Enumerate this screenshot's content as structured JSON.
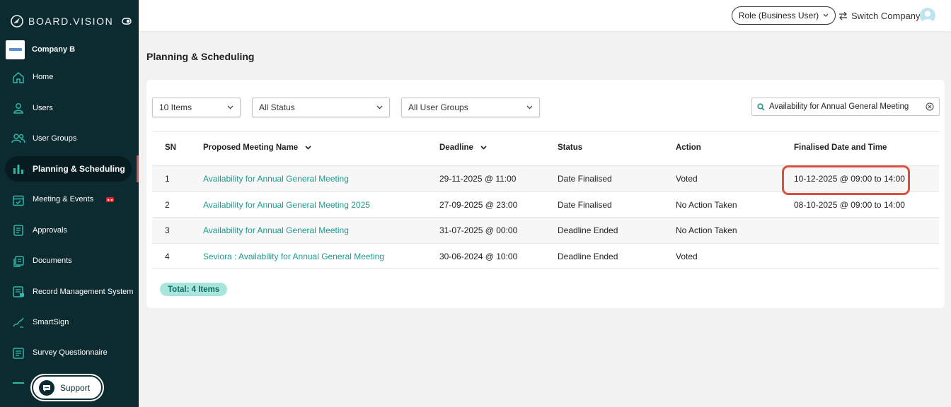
{
  "brand": {
    "name": "BOARD.VISION"
  },
  "company": {
    "name": "Company B"
  },
  "sidebar": {
    "items": [
      {
        "label": "Home",
        "icon": "home-icon"
      },
      {
        "label": "Users",
        "icon": "user-icon"
      },
      {
        "label": "User Groups",
        "icon": "user-group-icon"
      },
      {
        "label": "Planning & Scheduling",
        "icon": "bar-chart-icon",
        "active": true
      },
      {
        "label": "Meeting & Events",
        "icon": "calendar-check-icon",
        "badge": true
      },
      {
        "label": "Approvals",
        "icon": "document-icon"
      },
      {
        "label": "Documents",
        "icon": "documents-icon"
      },
      {
        "label": "Record Management System",
        "icon": "record-icon"
      },
      {
        "label": "SmartSign",
        "icon": "signature-icon"
      },
      {
        "label": "Survey Questionnaire",
        "icon": "survey-icon"
      }
    ],
    "support_label": "Support"
  },
  "topbar": {
    "role_label": "Role (Business User)",
    "switch_label": "Switch Company"
  },
  "page": {
    "title": "Planning & Scheduling"
  },
  "filters": {
    "items_per_page": "10 Items",
    "status": "All Status",
    "user_groups": "All User Groups",
    "search_value": "Availability for Annual General Meeting"
  },
  "table": {
    "headers": {
      "sn": "SN",
      "name": "Proposed Meeting Name",
      "deadline": "Deadline",
      "status": "Status",
      "action": "Action",
      "finalised": "Finalised Date and Time"
    },
    "rows": [
      {
        "sn": "1",
        "name": "Availability for Annual General Meeting",
        "deadline": "29-11-2025 @ 11:00",
        "status": "Date Finalised",
        "action": "Voted",
        "finalised": "10-12-2025 @ 09:00 to 14:00"
      },
      {
        "sn": "2",
        "name": "Availability for Annual General Meeting 2025",
        "deadline": "27-09-2025 @ 23:00",
        "status": "Date Finalised",
        "action": "No Action Taken",
        "finalised": "08-10-2025 @ 09:00 to 14:00"
      },
      {
        "sn": "3",
        "name": "Availability for Annual General Meeting",
        "deadline": "31-07-2025 @ 00:00",
        "status": "Deadline Ended",
        "action": "No Action Taken",
        "finalised": ""
      },
      {
        "sn": "4",
        "name": "Seviora : Availability for Annual General Meeting",
        "deadline": "30-06-2024 @ 10:00",
        "status": "Deadline Ended",
        "action": "Voted",
        "finalised": ""
      }
    ]
  },
  "footer": {
    "total_label": "Total: 4 Items"
  },
  "colors": {
    "sidebar_bg": "#0c2b30",
    "accent_teal": "#1d9a8e",
    "highlight_red": "#d9503f",
    "badge_bg": "#a8e6dd"
  }
}
